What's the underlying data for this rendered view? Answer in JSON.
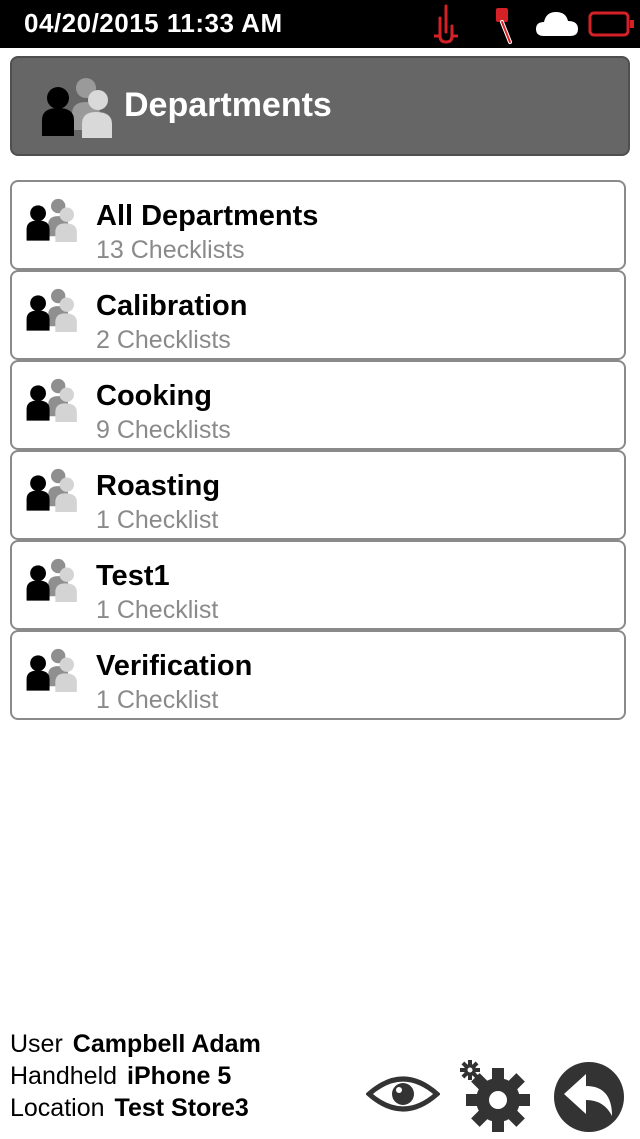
{
  "status_bar": {
    "datetime": "04/20/2015 11:33 AM",
    "icons": [
      "thermometer-probe-icon",
      "probe-icon",
      "cloud-icon",
      "battery-icon"
    ],
    "accent_color": "#d42127"
  },
  "header": {
    "title": "Departments",
    "icon": "people-group-icon",
    "background": "#666666"
  },
  "departments": [
    {
      "name": "All Departments",
      "count": "13 Checklists"
    },
    {
      "name": "Calibration",
      "count": "2 Checklists"
    },
    {
      "name": "Cooking",
      "count": "9 Checklists"
    },
    {
      "name": "Roasting",
      "count": "1 Checklist"
    },
    {
      "name": "Test1",
      "count": "1 Checklist"
    },
    {
      "name": "Verification",
      "count": "1 Checklist"
    }
  ],
  "footer": {
    "user_label": "User",
    "user_value": "Campbell Adam",
    "handheld_label": "Handheld",
    "handheld_value": "iPhone 5",
    "location_label": "Location",
    "location_value": "Test Store3",
    "buttons": [
      "eye-icon",
      "settings-gear-icon",
      "back-arrow-icon"
    ]
  }
}
